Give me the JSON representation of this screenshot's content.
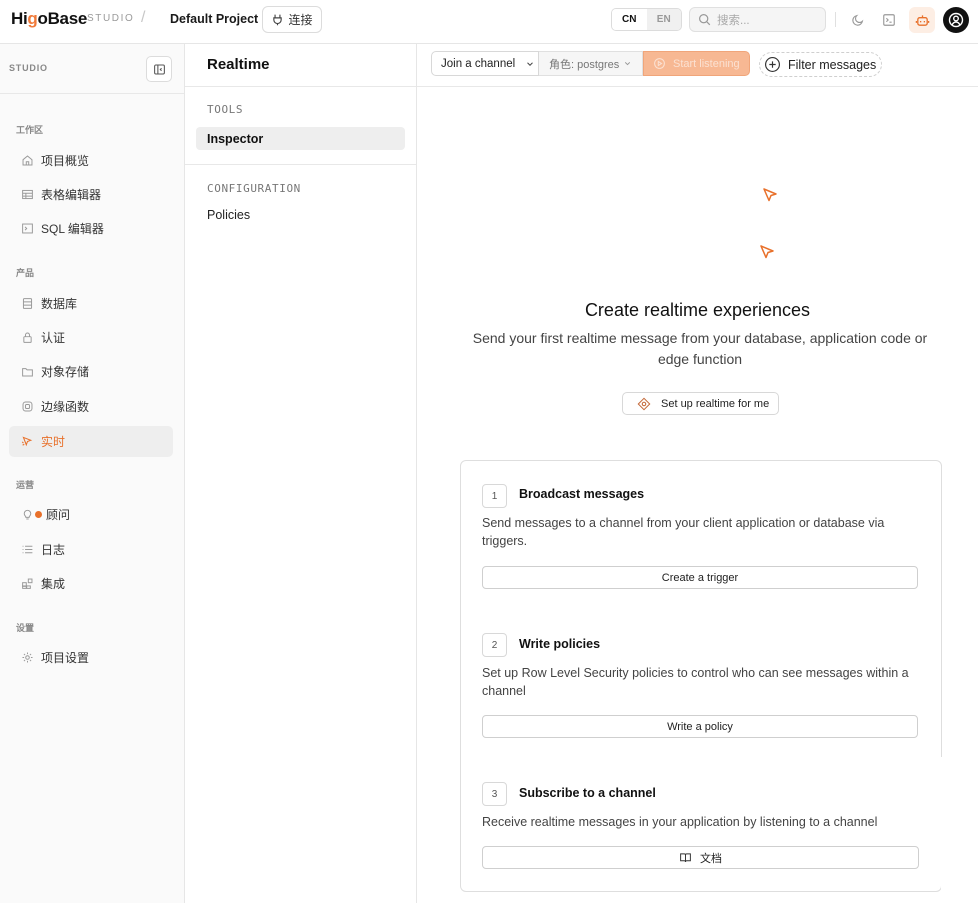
{
  "header": {
    "logo_prefix": "Hi",
    "logo_o": "g",
    "logo_suffix": "oBase",
    "studio_tag": "STUDIO",
    "separator": "/",
    "project_name": "Default Project",
    "connect_label": "连接",
    "lang_cn": "CN",
    "lang_en": "EN",
    "search_placeholder": "搜索..."
  },
  "sidebar": {
    "studio_label": "STUDIO",
    "section_workspace": "工作区",
    "section_product": "产品",
    "section_ops": "运营",
    "section_settings": "设置",
    "items": {
      "overview": "项目概览",
      "table_editor": "表格编辑器",
      "sql_editor": "SQL 编辑器",
      "database": "数据库",
      "auth": "认证",
      "storage": "对象存储",
      "edge_functions": "边缘函数",
      "realtime": "实时",
      "advisors": "顾问",
      "logs": "日志",
      "integrations": "集成",
      "project_settings": "项目设置"
    }
  },
  "middle": {
    "title": "Realtime",
    "tools_section": "TOOLS",
    "inspector": "Inspector",
    "config_section": "CONFIGURATION",
    "policies": "Policies"
  },
  "toolbar": {
    "join_channel": "Join a channel",
    "role_label": "角色: postgres",
    "start_listening": "Start listening",
    "filter_messages": "Filter messages"
  },
  "hero": {
    "title": "Create realtime experiences",
    "subtitle": "Send your first realtime message from your database, application code or edge function",
    "setup_button": "Set up realtime for me"
  },
  "steps": [
    {
      "num": "1",
      "title": "Broadcast messages",
      "desc": "Send messages to a channel from your client application or database via triggers.",
      "button": "Create a trigger"
    },
    {
      "num": "2",
      "title": "Write policies",
      "desc": "Set up Row Level Security policies to control who can see messages within a channel",
      "button": "Write a policy"
    },
    {
      "num": "3",
      "title": "Subscribe to a channel",
      "desc": "Receive realtime messages in your application by listening to a channel",
      "button": "文档"
    }
  ],
  "colors": {
    "accent": "#e8702a",
    "start_button_bg": "#f7b893"
  }
}
